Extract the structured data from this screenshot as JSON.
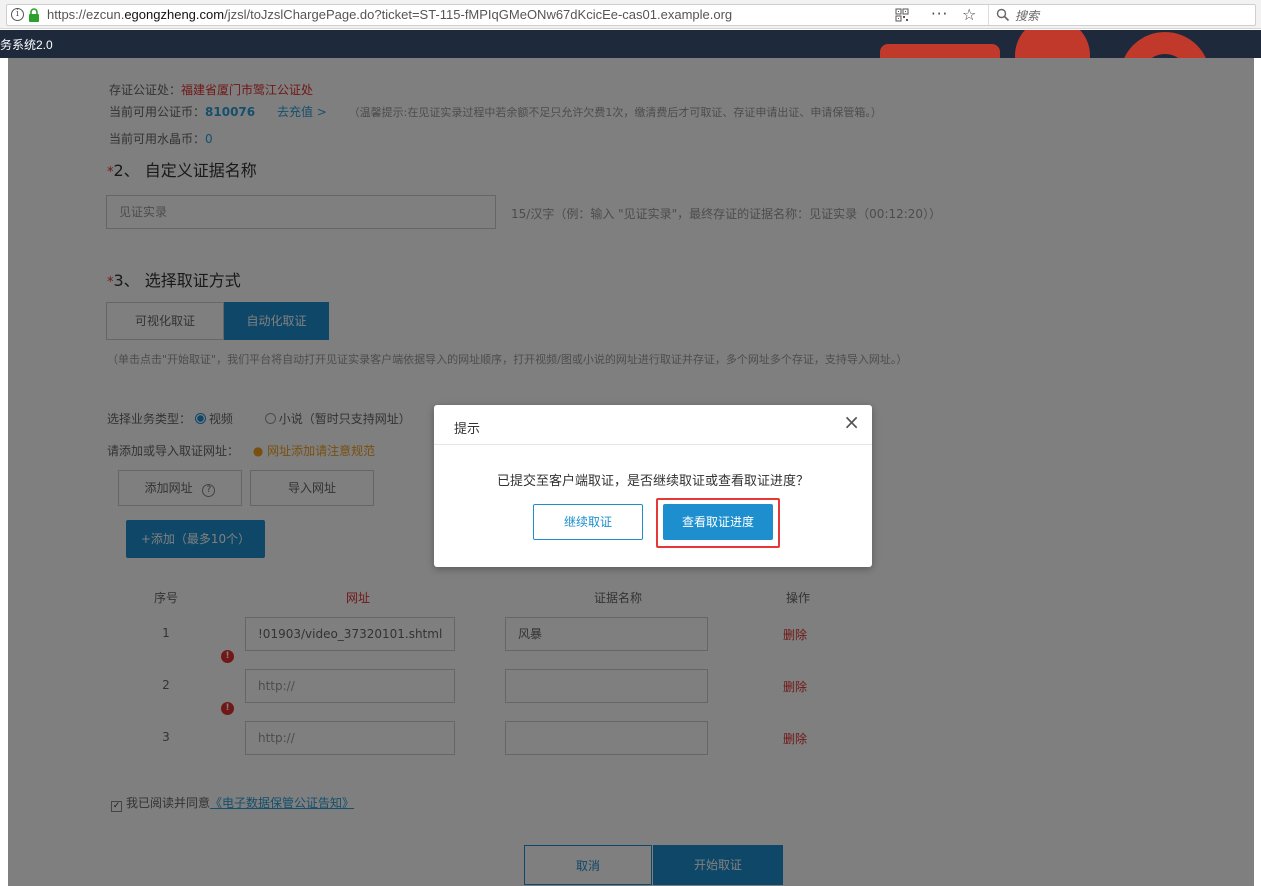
{
  "browser": {
    "url_prefix": "https://ezcun.",
    "url_domain": "egongzheng.com",
    "url_path": "/jzsl/toJzslChargePage.do?ticket=ST-115-fMPIqGMeONw67dKcicEe-cas01.example.org",
    "more": "···",
    "search_placeholder": "搜索"
  },
  "site": {
    "title": "务系统2.0"
  },
  "page": {
    "notary_label": "存证公证处：",
    "notary_value": "福建省厦门市鹭江公证处",
    "coins_label": "当前可用公证币：",
    "coins_value": "810076",
    "recharge_link": "去充值 >",
    "coins_hint": "（温馨提示:在见证实录过程中若余额不足只允许欠费1次，缴清费后才可取证、存证申请出证、申请保管箱。）",
    "crystal_label": "当前可用水晶币：",
    "crystal_value": "0",
    "section2_star": "*",
    "section2_title": "2、 自定义证据名称",
    "evidence_name_value": "见证实录",
    "evidence_name_hint": "15/汉字（例：输入 \"见证实录\"，最终存证的证据名称：见证实录（00:12:20））",
    "section3_star": "*",
    "section3_title": "3、 选择取证方式",
    "tab_visual": "可视化取证",
    "tab_auto": "自动化取证",
    "auto_hint": "（单击点击\"开始取证\"，我们平台将自动打开见证实录客户端依据导入的网址顺序，打开视频/图或小说的网址进行取证并存证，多个网址多个存证，支持导入网址。）",
    "biz_type_label": "选择业务类型：",
    "biz_video": "视频",
    "biz_novel": "小说（暂时只支持网址）",
    "add_url_label": "请添加或导入取证网址：",
    "add_url_warn": "网址添加请注意规范",
    "btn_add_url": "添加网址",
    "help_icon": "?",
    "btn_import_url": "导入网址",
    "btn_add_more": "+添加（最多10个）",
    "table": {
      "headers": [
        "序号",
        "网址",
        "证据名称",
        "操作"
      ],
      "rows": [
        {
          "index": "1",
          "url": "!01903/video_37320101.shtml",
          "name": "风暴",
          "action": "删除"
        },
        {
          "index": "2",
          "url": "http://",
          "name": "",
          "action": "删除"
        },
        {
          "index": "3",
          "url": "http://",
          "name": "",
          "action": "删除"
        }
      ]
    },
    "agree_check": "✓",
    "agree_text": "我已阅读并同意",
    "agree_link": "《电子数据保管公证告知》",
    "btn_cancel": "取消",
    "btn_start": "开始取证"
  },
  "modal": {
    "title": "提示",
    "close": "×",
    "message": "已提交至客户端取证，是否继续取证或查看取证进度？",
    "btn_continue": "继续取证",
    "btn_view_progress": "查看取证进度"
  },
  "colors": {
    "primary": "#1d8fcf",
    "error": "#e03030",
    "highlight": "#e53935",
    "header_bg": "#1e2a3c"
  }
}
